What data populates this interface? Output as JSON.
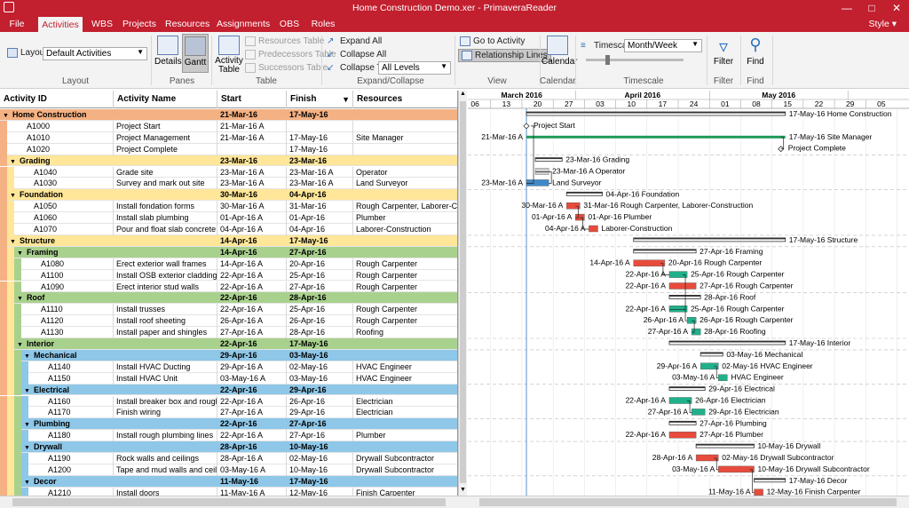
{
  "window": {
    "title": "Home Construction Demo.xer - PrimaveraReader",
    "style_label": "Style"
  },
  "tabs": [
    {
      "label": "File"
    },
    {
      "label": "Activities",
      "active": true
    },
    {
      "label": "WBS"
    },
    {
      "label": "Projects"
    },
    {
      "label": "Resources"
    },
    {
      "label": "Assignments"
    },
    {
      "label": "OBS"
    },
    {
      "label": "Roles"
    }
  ],
  "ribbon": {
    "layout": {
      "label": "Layout",
      "value": "Default Activities",
      "group": "Layout"
    },
    "panes": {
      "details": "Details",
      "gantt": "Gantt",
      "group": "Panes"
    },
    "table": {
      "activity_table": "Activity Table",
      "resources_table": "Resources Table",
      "predecessors_table": "Predecessors Table",
      "successors_table": "Successors Table",
      "group": "Table"
    },
    "expand": {
      "expand_all": "Expand All",
      "collapse_all": "Collapse All",
      "collapse_to": "Collapse To",
      "level": "All Levels",
      "group": "Expand/Collapse"
    },
    "view": {
      "goto": "Go to Activity",
      "relationship": "Relationship Lines",
      "group": "View"
    },
    "calendar": {
      "label": "Calendar",
      "group": "Calendar"
    },
    "timescale": {
      "label": "Timescale",
      "value": "Month/Week",
      "group": "Timescale"
    },
    "filter": {
      "label": "Filter",
      "group": "Filter"
    },
    "find": {
      "label": "Find",
      "group": "Find"
    }
  },
  "columns": {
    "id": "Activity ID",
    "name": "Activity Name",
    "start": "Start",
    "finish": "Finish",
    "resources": "Resources"
  },
  "rows": [
    {
      "lvl": 0,
      "wbs": true,
      "c": "wbs1",
      "id": "Home Construction",
      "start": "21-Mar-16",
      "finish": "17-May-16"
    },
    {
      "lvl": 1,
      "id": "A1000",
      "name": "Project Start",
      "start": "21-Mar-16 A",
      "finish": "",
      "res": ""
    },
    {
      "lvl": 1,
      "id": "A1010",
      "name": "Project Management",
      "start": "21-Mar-16 A",
      "finish": "17-May-16",
      "res": "Site Manager"
    },
    {
      "lvl": 1,
      "id": "A1020",
      "name": "Project Complete",
      "start": "",
      "finish": "17-May-16",
      "res": ""
    },
    {
      "lvl": 1,
      "wbs": true,
      "c": "wbs2",
      "id": "Grading",
      "start": "23-Mar-16",
      "finish": "23-Mar-16"
    },
    {
      "lvl": 2,
      "id": "A1040",
      "name": "Grade site",
      "start": "23-Mar-16 A",
      "finish": "23-Mar-16 A",
      "res": "Operator"
    },
    {
      "lvl": 2,
      "id": "A1030",
      "name": "Survey and mark out site",
      "start": "23-Mar-16 A",
      "finish": "23-Mar-16 A",
      "res": "Land Surveyor"
    },
    {
      "lvl": 1,
      "wbs": true,
      "c": "wbs2",
      "id": "Foundation",
      "start": "30-Mar-16",
      "finish": "04-Apr-16"
    },
    {
      "lvl": 2,
      "id": "A1050",
      "name": "Install fondation forms",
      "start": "30-Mar-16 A",
      "finish": "31-Mar-16",
      "res": "Rough Carpenter, Laborer-Construction"
    },
    {
      "lvl": 2,
      "id": "A1060",
      "name": "Install slab plumbing",
      "start": "01-Apr-16 A",
      "finish": "01-Apr-16",
      "res": "Plumber"
    },
    {
      "lvl": 2,
      "id": "A1070",
      "name": "Pour and float slab concrete",
      "start": "04-Apr-16 A",
      "finish": "04-Apr-16",
      "res": "Laborer-Construction"
    },
    {
      "lvl": 1,
      "wbs": true,
      "c": "wbs2",
      "id": "Structure",
      "start": "14-Apr-16",
      "finish": "17-May-16"
    },
    {
      "lvl": 2,
      "wbs": true,
      "c": "wbs3",
      "id": "Framing",
      "start": "14-Apr-16",
      "finish": "27-Apr-16"
    },
    {
      "lvl": 3,
      "id": "A1080",
      "name": "Erect exterior wall frames",
      "start": "14-Apr-16 A",
      "finish": "20-Apr-16",
      "res": "Rough Carpenter"
    },
    {
      "lvl": 3,
      "id": "A1100",
      "name": "Install OSB exterior cladding",
      "start": "22-Apr-16 A",
      "finish": "25-Apr-16",
      "res": "Rough Carpenter"
    },
    {
      "lvl": 3,
      "id": "A1090",
      "name": "Erect interior stud walls",
      "start": "22-Apr-16 A",
      "finish": "27-Apr-16",
      "res": "Rough Carpenter"
    },
    {
      "lvl": 2,
      "wbs": true,
      "c": "wbs3",
      "id": "Roof",
      "start": "22-Apr-16",
      "finish": "28-Apr-16"
    },
    {
      "lvl": 3,
      "id": "A1110",
      "name": "Install trusses",
      "start": "22-Apr-16 A",
      "finish": "25-Apr-16",
      "res": "Rough Carpenter"
    },
    {
      "lvl": 3,
      "id": "A1120",
      "name": "Install roof sheeting",
      "start": "26-Apr-16 A",
      "finish": "26-Apr-16",
      "res": "Rough Carpenter"
    },
    {
      "lvl": 3,
      "id": "A1130",
      "name": "Install paper and shingles",
      "start": "27-Apr-16 A",
      "finish": "28-Apr-16",
      "res": "Roofing"
    },
    {
      "lvl": 2,
      "wbs": true,
      "c": "wbs3",
      "id": "Interior",
      "start": "22-Apr-16",
      "finish": "17-May-16"
    },
    {
      "lvl": 3,
      "wbs": true,
      "c": "wbs4",
      "id": "Mechanical",
      "start": "29-Apr-16",
      "finish": "03-May-16"
    },
    {
      "lvl": 4,
      "id": "A1140",
      "name": "Install HVAC Ducting",
      "start": "29-Apr-16 A",
      "finish": "02-May-16",
      "res": "HVAC Engineer"
    },
    {
      "lvl": 4,
      "id": "A1150",
      "name": "Install HVAC Unit",
      "start": "03-May-16 A",
      "finish": "03-May-16",
      "res": "HVAC Engineer"
    },
    {
      "lvl": 3,
      "wbs": true,
      "c": "wbs4",
      "id": "Electrical",
      "start": "22-Apr-16",
      "finish": "29-Apr-16"
    },
    {
      "lvl": 4,
      "id": "A1160",
      "name": "Install breaker box and rough wiring",
      "start": "22-Apr-16 A",
      "finish": "26-Apr-16",
      "res": "Electrician"
    },
    {
      "lvl": 4,
      "id": "A1170",
      "name": "Finish wiring",
      "start": "27-Apr-16 A",
      "finish": "29-Apr-16",
      "res": "Electrician"
    },
    {
      "lvl": 3,
      "wbs": true,
      "c": "wbs4",
      "id": "Plumbing",
      "start": "22-Apr-16",
      "finish": "27-Apr-16"
    },
    {
      "lvl": 4,
      "id": "A1180",
      "name": "Install rough plumbing lines",
      "start": "22-Apr-16 A",
      "finish": "27-Apr-16",
      "res": "Plumber"
    },
    {
      "lvl": 3,
      "wbs": true,
      "c": "wbs4",
      "id": "Drywall",
      "start": "28-Apr-16",
      "finish": "10-May-16"
    },
    {
      "lvl": 4,
      "id": "A1190",
      "name": "Rock walls and ceilings",
      "start": "28-Apr-16 A",
      "finish": "02-May-16",
      "res": "Drywall Subcontractor"
    },
    {
      "lvl": 4,
      "id": "A1200",
      "name": "Tape and mud walls and ceilings",
      "start": "03-May-16 A",
      "finish": "10-May-16",
      "res": "Drywall Subcontractor"
    },
    {
      "lvl": 3,
      "wbs": true,
      "c": "wbs4",
      "id": "Decor",
      "start": "11-May-16",
      "finish": "17-May-16"
    },
    {
      "lvl": 4,
      "id": "A1210",
      "name": "Install doors",
      "start": "11-May-16 A",
      "finish": "12-May-16",
      "res": "Finish Carpenter"
    }
  ],
  "gantt": {
    "months": [
      {
        "label": "March 2016",
        "d0": -20,
        "d1": 10
      },
      {
        "label": "April 2016",
        "d0": 11,
        "d1": 40
      },
      {
        "label": "May 2016",
        "d0": 41,
        "d1": 71
      }
    ],
    "weeks": [
      "06",
      "13",
      "20",
      "27",
      "03",
      "10",
      "17",
      "24",
      "01",
      "08",
      "15",
      "22",
      "29",
      "05"
    ],
    "bars": [
      {
        "type": "summary",
        "s": 0,
        "f": 57,
        "lt": "",
        "rt": "17-May-16  Home Construction"
      },
      {
        "type": "milestone",
        "s": 0,
        "lt": "",
        "rt": "Project Start"
      },
      {
        "type": "loe",
        "s": 0,
        "f": 57,
        "lt": "21-Mar-16 A",
        "rt": "17-May-16  Site Manager"
      },
      {
        "type": "milestone",
        "s": 57,
        "lt": "",
        "rt": "Project Complete"
      },
      {
        "type": "summary",
        "s": 2,
        "f": 7,
        "lt": "",
        "rt": "23-Mar-16  Grading"
      },
      {
        "type": "act",
        "s": 2,
        "f": 4,
        "c": "#d0d0d0",
        "lt": "",
        "rt": "23-Mar-16 A  Operator"
      },
      {
        "type": "act",
        "s": 0,
        "f": 4,
        "c": "#3f89c9",
        "lt": "23-Mar-16 A",
        "rt": "Land Surveyor"
      },
      {
        "type": "summary",
        "s": 9,
        "f": 16,
        "lt": "",
        "rt": "04-Apr-16  Foundation"
      },
      {
        "type": "act",
        "s": 9,
        "f": 11,
        "c": "#e84b3c",
        "lt": "30-Mar-16 A",
        "rt": "31-Mar-16  Rough Carpenter, Laborer-Construction"
      },
      {
        "type": "act",
        "s": 11,
        "f": 12,
        "c": "#e84b3c",
        "lt": "01-Apr-16 A",
        "rt": "01-Apr-16  Plumber"
      },
      {
        "type": "act",
        "s": 14,
        "f": 15,
        "c": "#e84b3c",
        "lt": "04-Apr-16 A",
        "rt": "Laborer-Construction"
      },
      {
        "type": "summary",
        "s": 24,
        "f": 57,
        "lt": "",
        "rt": "17-May-16  Structure"
      },
      {
        "type": "summary",
        "s": 24,
        "f": 37,
        "lt": "",
        "rt": "27-Apr-16  Framing"
      },
      {
        "type": "act",
        "s": 24,
        "f": 30,
        "c": "#e84b3c",
        "lt": "14-Apr-16 A",
        "rt": "20-Apr-16  Rough Carpenter"
      },
      {
        "type": "act",
        "s": 32,
        "f": 35,
        "c": "#20b08a",
        "lt": "22-Apr-16 A",
        "rt": "25-Apr-16  Rough Carpenter"
      },
      {
        "type": "act",
        "s": 32,
        "f": 37,
        "c": "#e84b3c",
        "lt": "22-Apr-16 A",
        "rt": "27-Apr-16  Rough Carpenter"
      },
      {
        "type": "summary",
        "s": 32,
        "f": 38,
        "lt": "",
        "rt": "28-Apr-16  Roof"
      },
      {
        "type": "act",
        "s": 32,
        "f": 35,
        "c": "#20b08a",
        "lt": "22-Apr-16 A",
        "rt": "25-Apr-16  Rough Carpenter"
      },
      {
        "type": "act",
        "s": 36,
        "f": 37,
        "c": "#20b08a",
        "lt": "26-Apr-16 A",
        "rt": "26-Apr-16  Rough Carpenter"
      },
      {
        "type": "act",
        "s": 37,
        "f": 38,
        "c": "#20b08a",
        "lt": "27-Apr-16 A",
        "rt": "28-Apr-16  Roofing"
      },
      {
        "type": "summary",
        "s": 32,
        "f": 57,
        "lt": "",
        "rt": "17-May-16  Interior"
      },
      {
        "type": "summary",
        "s": 39,
        "f": 43,
        "lt": "",
        "rt": "03-May-16  Mechanical"
      },
      {
        "type": "act",
        "s": 39,
        "f": 42,
        "c": "#20b08a",
        "lt": "29-Apr-16 A",
        "rt": "02-May-16  HVAC Engineer"
      },
      {
        "type": "act",
        "s": 43,
        "f": 44,
        "c": "#20b08a",
        "lt": "03-May-16 A",
        "rt": "HVAC Engineer"
      },
      {
        "type": "summary",
        "s": 32,
        "f": 39,
        "lt": "",
        "rt": "29-Apr-16  Electrical"
      },
      {
        "type": "act",
        "s": 32,
        "f": 36,
        "c": "#20b08a",
        "lt": "22-Apr-16 A",
        "rt": "26-Apr-16  Electrician"
      },
      {
        "type": "act",
        "s": 37,
        "f": 39,
        "c": "#20b08a",
        "lt": "27-Apr-16 A",
        "rt": "29-Apr-16  Electrician"
      },
      {
        "type": "summary",
        "s": 32,
        "f": 37,
        "lt": "",
        "rt": "27-Apr-16  Plumbing"
      },
      {
        "type": "act",
        "s": 32,
        "f": 37,
        "c": "#e84b3c",
        "lt": "22-Apr-16 A",
        "rt": "27-Apr-16  Plumber"
      },
      {
        "type": "summary",
        "s": 38,
        "f": 50,
        "lt": "",
        "rt": "10-May-16  Drywall"
      },
      {
        "type": "act",
        "s": 38,
        "f": 42,
        "c": "#e84b3c",
        "lt": "28-Apr-16 A",
        "rt": "02-May-16  Drywall Subcontractor"
      },
      {
        "type": "act",
        "s": 43,
        "f": 50,
        "c": "#e84b3c",
        "lt": "03-May-16 A",
        "rt": "10-May-16  Drywall Subcontractor"
      },
      {
        "type": "summary",
        "s": 51,
        "f": 57,
        "lt": "",
        "rt": "17-May-16  Decor"
      },
      {
        "type": "act",
        "s": 51,
        "f": 52,
        "c": "#e84b3c",
        "lt": "11-May-16 A",
        "rt": "12-May-16  Finish Carpenter"
      }
    ]
  }
}
